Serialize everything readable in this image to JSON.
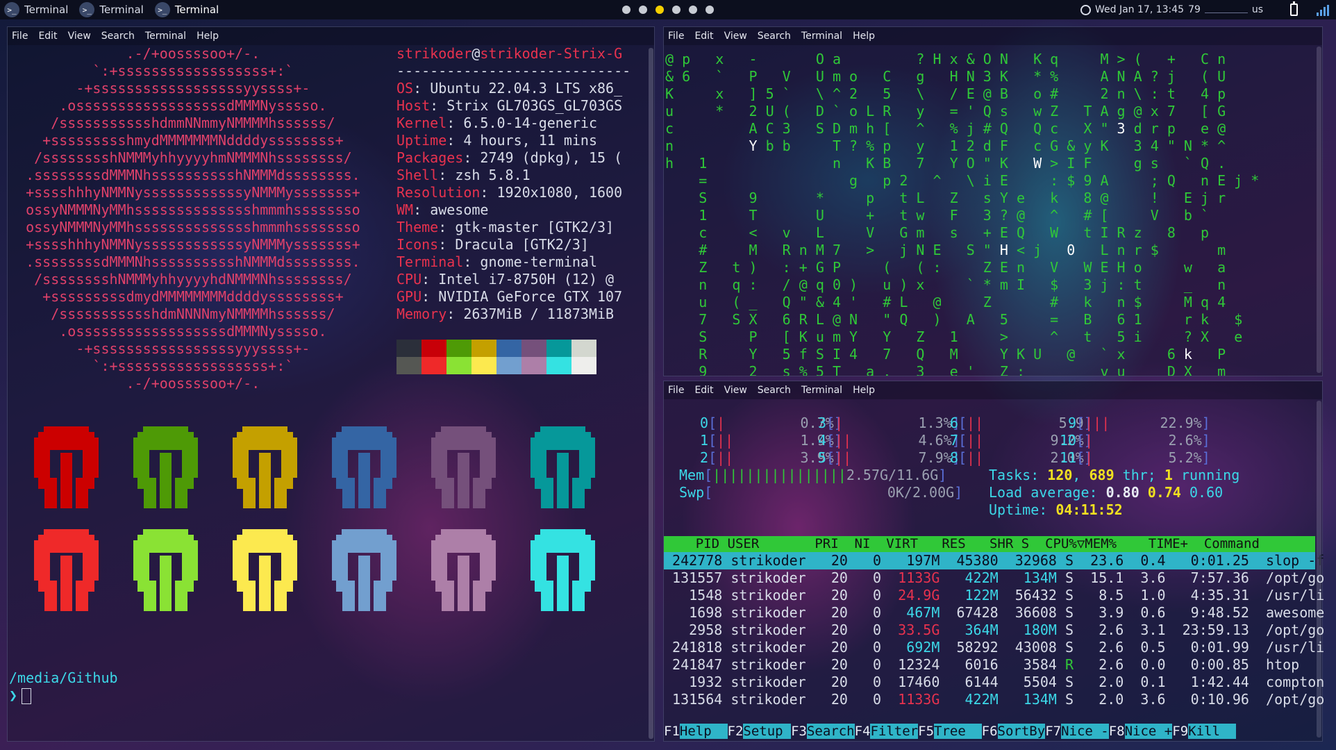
{
  "topbar": {
    "tabs": [
      {
        "label": "Terminal",
        "active": false
      },
      {
        "label": "Terminal",
        "active": false
      },
      {
        "label": "Terminal",
        "active": true
      }
    ],
    "tab_icon": ">_",
    "workspaces": 6,
    "active_workspace": 3,
    "clock": "Wed Jan 17, 13:45",
    "cpu_temp": "79",
    "net_unit": "us"
  },
  "menu": [
    "File",
    "Edit",
    "View",
    "Search",
    "Terminal",
    "Help"
  ],
  "neofetch": {
    "art": [
      "              .-/+oossssoo+/-.",
      "          `:+ssssssssssssssssss+:`",
      "        -+ssssssssssssssssssyyssss+-",
      "      .ossssssssssssssssssdMMMNysssso.",
      "     /ssssssssssshdmmNNmmyNMMMMhssssss/",
      "    +ssssssssshmydMMMMMMMNddddyssssssss+",
      "   /sssssssshNMMMyhhyyyyhmNMMMNhssssssss/",
      "  .ssssssssdMMMNhsssssssssshNMMMdssssssss.",
      "  +sssshhhyNMMNyssssssssssssyNMMMysssssss+",
      "  ossyNMMMNyMMhsssssssssssssshmmmhssssssso",
      "  ossyNMMMNyMMhsssssssssssssshmmmhssssssso",
      "  +sssshhhyNMMNyssssssssssssyNMMMysssssss+",
      "  .ssssssssdMMMNhsssssssssshNMMMdssssssss.",
      "   /sssssssshNMMMyhhyyyyhdNMMMNhssssssss/",
      "    +sssssssssdmydMMMMMMMMddddyssssssss+",
      "     /ssssssssssshdmNNNNmyNMMMMhssssss/",
      "      .ossssssssssssssssssdMMMNysssso.",
      "        -+sssssssssssssssssyyyssss+-",
      "          `:+ssssssssssssssssss+:`",
      "              .-/+oossssoo+/-."
    ],
    "user": "strikoder",
    "host": "strikoder-Strix-G",
    "separator": "----------------------------",
    "fields": [
      {
        "key": "OS",
        "value": "Ubuntu 22.04.3 LTS x86_"
      },
      {
        "key": "Host",
        "value": "Strix GL703GS_GL703GS"
      },
      {
        "key": "Kernel",
        "value": "6.5.0-14-generic"
      },
      {
        "key": "Uptime",
        "value": "4 hours, 11 mins"
      },
      {
        "key": "Packages",
        "value": "2749 (dpkg), 15 ("
      },
      {
        "key": "Shell",
        "value": "zsh 5.8.1"
      },
      {
        "key": "Resolution",
        "value": "1920x1080, 1600"
      },
      {
        "key": "WM",
        "value": "awesome"
      },
      {
        "key": "Theme",
        "value": "gtk-master [GTK2/3]"
      },
      {
        "key": "Icons",
        "value": "Dracula [GTK2/3]"
      },
      {
        "key": "Terminal",
        "value": "gnome-terminal"
      },
      {
        "key": "CPU",
        "value": "Intel i7-8750H (12) @"
      },
      {
        "key": "GPU",
        "value": "NVIDIA GeForce GTX 107"
      },
      {
        "key": "Memory",
        "value": "2637MiB / 11873MiB"
      }
    ],
    "palette": [
      "#2b2f3a",
      "#c80008",
      "#4e9a06",
      "#c4a000",
      "#3465a4",
      "#75507b",
      "#06989a",
      "#d3d7cf",
      "#555753",
      "#ef2929",
      "#8ae234",
      "#fce94f",
      "#729fcf",
      "#ad7fa8",
      "#34e2e2",
      "#eeeeec"
    ],
    "helmet_colors": [
      "#cc0000",
      "#4e9a06",
      "#c4a000",
      "#3465a4",
      "#75507b",
      "#06989a",
      "#ef2929",
      "#8ae234",
      "#fce94f",
      "#729fcf",
      "#ad7fa8",
      "#34e2e2"
    ],
    "cwd": "/media/Github",
    "prompt_char": "❯"
  },
  "matrix": {
    "rows": [
      "@ p   x   -       O a         ? H x & O N   K q     M > (   +   C n",
      "& 6   `   P   V   U m o   C   g   H N 3 K   * %     A N A ? j   ( U",
      "K     x   ] 5 `   \\ ^ 2   5   \\   / E @ B   o #     2 n \\ : t   4 p",
      "u     *   2 U (   D ` o L R   y   = ' Q s   w Z   T A g @ x 7   [ G",
      "c         A C 3   S D m h [   ^   % j # Q   Q c   X \" 3 d r p   e @",
      "n         Y b b     T ? % p   y   1 2 d F   c G & y K   3 4 \" N * ^",
      "h   1               n   K B   7   Y O \" K   W > I F     g s   ` Q .",
      "    =                 g   p 2   ^   \\ i E     : $ 9 A     ; Q   n E j *",
      "    S     9       *     p   t L   Z   s Y e   k   8 @     !   E j r",
      "    1     T       U     +   t w   F   3 ? @   ^   # [     V   b `",
      "    c     <   v   L     V   G m   s   + E Q   W   t I R z   8   p",
      "    #     M   R n M 7   >   j N E   S \" H < j   0   L n r $       m",
      "    Z   t )   : + G P     (   ( :     Z E n   V   W E H o     w   a",
      "    n   q :   / @ q 0 )   u ) x     ` * m I   $   3 j : t     _   n",
      "    u   ( _   Q \" & 4 '   # L   @     Z       #   k   n $     M q 4",
      "    7   S X   6 R L @ N   \" Q   )   A   5     =   B   6 1     r k   $",
      "    S     P   [ K u m Y   Y   Z   1     >     ^   t   5 i     ? X   e",
      "    R     Y   5 f S I 4   7   Q   M     Y K U   @   ` x     6 k   P",
      "    9     2   s % 5 T   a ,   3   e '   Z ;         v u     D X   m"
    ]
  },
  "htop": {
    "cpus": [
      {
        "n": "0",
        "bar": "|",
        "pct": "0.7%"
      },
      {
        "n": "1",
        "bar": "||",
        "pct": "1.9%"
      },
      {
        "n": "2",
        "bar": "||",
        "pct": "3.9%"
      },
      {
        "n": "3",
        "bar": "|",
        "pct": "1.3%"
      },
      {
        "n": "4",
        "bar": "||",
        "pct": "4.6%"
      },
      {
        "n": "5",
        "bar": "||",
        "pct": "7.9%"
      },
      {
        "n": "6",
        "bar": "||",
        "pct": "5.9"
      },
      {
        "n": "7",
        "bar": "||",
        "pct": "9.2%"
      },
      {
        "n": "8",
        "bar": "||",
        "pct": "2.0%"
      },
      {
        "n": "9",
        "bar": "|||",
        "pct": "22.9%"
      },
      {
        "n": "10",
        "bar": "|",
        "pct": "2.6%"
      },
      {
        "n": "11",
        "bar": "|",
        "pct": "5.2%"
      }
    ],
    "mem_label": "Mem",
    "mem_bar": "||||||||||||||||",
    "mem_value": "2.57G/11.6G",
    "swp_label": "Swp",
    "swp_value": "0K/2.00G",
    "tasks_label": "Tasks:",
    "tasks": "120",
    "thr": "689",
    "thr_label": "thr;",
    "running": "1",
    "running_label": "running",
    "load_label": "Load average:",
    "load1": "0.80",
    "load5": "0.74",
    "load15": "0.60",
    "uptime_label": "Uptime:",
    "uptime": "04:11:52",
    "header": "    PID USER       PRI  NI  VIRT   RES   SHR S  CPU%▽MEM%    TIME+  Command",
    "processes": [
      {
        "pid": "242778",
        "user": "strikoder",
        "pri": "20",
        "ni": "0",
        "virt": "197M",
        "res": "45380",
        "shr": "32968",
        "s": "S",
        "cpu": "23.6",
        "mem": "0.4",
        "time": "0:01.25",
        "cmd": "slop -f"
      },
      {
        "pid": "131557",
        "user": "strikoder",
        "pri": "20",
        "ni": "0",
        "virt": "1133G",
        "res": "422M",
        "shr": "134M",
        "s": "S",
        "cpu": "15.1",
        "mem": "3.6",
        "time": "7:57.36",
        "cmd": "/opt/go"
      },
      {
        "pid": "1548",
        "user": "strikoder",
        "pri": "20",
        "ni": "0",
        "virt": "24.9G",
        "res": "122M",
        "shr": "56432",
        "s": "S",
        "cpu": "8.5",
        "mem": "1.0",
        "time": "4:35.31",
        "cmd": "/usr/li"
      },
      {
        "pid": "1698",
        "user": "strikoder",
        "pri": "20",
        "ni": "0",
        "virt": "467M",
        "res": "67428",
        "shr": "36608",
        "s": "S",
        "cpu": "3.9",
        "mem": "0.6",
        "time": "9:48.52",
        "cmd": "awesome"
      },
      {
        "pid": "2958",
        "user": "strikoder",
        "pri": "20",
        "ni": "0",
        "virt": "33.5G",
        "res": "364M",
        "shr": "180M",
        "s": "S",
        "cpu": "2.6",
        "mem": "3.1",
        "time": "23:59.13",
        "cmd": "/opt/go"
      },
      {
        "pid": "241818",
        "user": "strikoder",
        "pri": "20",
        "ni": "0",
        "virt": "692M",
        "res": "58292",
        "shr": "43008",
        "s": "S",
        "cpu": "2.6",
        "mem": "0.5",
        "time": "0:01.99",
        "cmd": "/usr/li"
      },
      {
        "pid": "241847",
        "user": "strikoder",
        "pri": "20",
        "ni": "0",
        "virt": "12324",
        "res": "6016",
        "shr": "3584",
        "s": "R",
        "cpu": "2.6",
        "mem": "0.0",
        "time": "0:00.85",
        "cmd": "htop"
      },
      {
        "pid": "1932",
        "user": "strikoder",
        "pri": "20",
        "ni": "0",
        "virt": "17460",
        "res": "6144",
        "shr": "5504",
        "s": "S",
        "cpu": "2.0",
        "mem": "0.1",
        "time": "1:42.44",
        "cmd": "compton"
      },
      {
        "pid": "131564",
        "user": "strikoder",
        "pri": "20",
        "ni": "0",
        "virt": "1133G",
        "res": "422M",
        "shr": "134M",
        "s": "S",
        "cpu": "2.0",
        "mem": "3.6",
        "time": "0:10.96",
        "cmd": "/opt/go"
      }
    ],
    "fkeys": [
      {
        "key": "F1",
        "label": "Help"
      },
      {
        "key": "F2",
        "label": "Setup"
      },
      {
        "key": "F3",
        "label": "Search"
      },
      {
        "key": "F4",
        "label": "Filter"
      },
      {
        "key": "F5",
        "label": "Tree"
      },
      {
        "key": "F6",
        "label": "SortBy"
      },
      {
        "key": "F7",
        "label": "Nice -"
      },
      {
        "key": "F8",
        "label": "Nice +"
      },
      {
        "key": "F9",
        "label": "Kill"
      }
    ]
  }
}
